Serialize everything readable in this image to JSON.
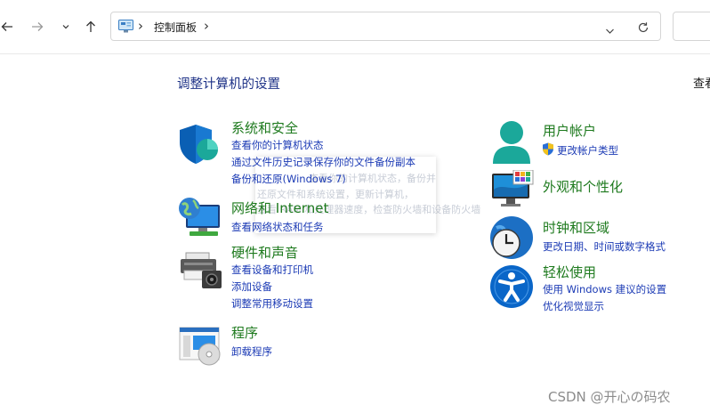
{
  "address_bar": {
    "breadcrumb": "控制面板",
    "icons": [
      "back-arrow-icon",
      "forward-arrow-icon",
      "recent-dropdown-icon",
      "up-arrow-icon",
      "control-panel-icon",
      "breadcrumb-chevron-icon",
      "address-dropdown-icon",
      "refresh-icon"
    ]
  },
  "header": {
    "title": "调整计算机的设置",
    "view_by_label": "查看"
  },
  "categories": {
    "system_security": {
      "title": "系统和安全",
      "icon": "shield-icon",
      "links": [
        "查看你的计算机状态",
        "通过文件历史记录保存你的文件备份副本",
        "备份和还原(Windows 7)"
      ]
    },
    "network": {
      "title": "网络和 Internet",
      "icon": "network-globe-icon",
      "links": [
        "查看网络状态和任务"
      ]
    },
    "hardware_sound": {
      "title": "硬件和声音",
      "icon": "printer-speaker-icon",
      "links": [
        "查看设备和打印机",
        "添加设备",
        "调整常用移动设置"
      ]
    },
    "programs": {
      "title": "程序",
      "icon": "programs-disc-icon",
      "links": [
        "卸载程序"
      ]
    },
    "user_accounts": {
      "title": "用户帐户",
      "icon": "user-icon",
      "links": [
        "更改帐户类型"
      ]
    },
    "appearance": {
      "title": "外观和个性化",
      "icon": "monitor-personalize-icon"
    },
    "clock_region": {
      "title": "时钟和区域",
      "icon": "clock-globe-icon",
      "links": [
        "更改日期、时间或数字格式"
      ]
    },
    "ease_of_access": {
      "title": "轻松使用",
      "icon": "accessibility-icon",
      "links": [
        "使用 Windows 建议的设置",
        "优化视觉显示"
      ]
    }
  },
  "tooltip_ghost": {
    "lines": [
      "查看你的计算机状态，备份并",
      "还原文件和系统设置，更新计算机，",
      "查看 RAM 和处理器速度，检查防火墙和设备防火墙"
    ]
  },
  "watermark": "CSDN @开心の码农",
  "colors": {
    "category_title": "#1e7a1e",
    "link": "#1c3bb5",
    "page_title": "#1e3287",
    "accent_teal": "#1ba89a",
    "accent_blue": "#0a5fb4"
  }
}
